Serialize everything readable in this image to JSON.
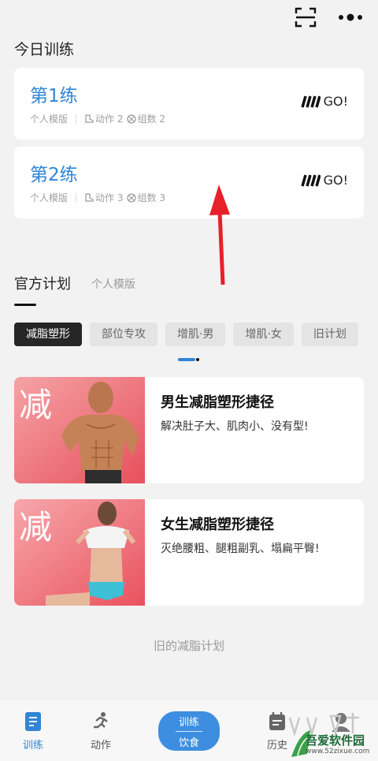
{
  "topbar": {
    "icons": [
      "scan-icon",
      "more-icon"
    ]
  },
  "today": {
    "title": "今日训练",
    "cards": [
      {
        "name": "第1练",
        "source": "个人模版",
        "action_label": "动作",
        "action_count": "2",
        "sets_label": "组数",
        "sets_count": "2",
        "go": "GO!"
      },
      {
        "name": "第2练",
        "source": "个人模版",
        "action_label": "动作",
        "action_count": "3",
        "sets_label": "组数",
        "sets_count": "3",
        "go": "GO!"
      }
    ]
  },
  "plans_tabs": {
    "official": "官方计划",
    "personal": "个人模版"
  },
  "categories": [
    "减脂塑形",
    "部位专攻",
    "增肌·男",
    "增肌·女",
    "旧计划"
  ],
  "selected_category": "减脂塑形",
  "plans": [
    {
      "thumb_text": "减",
      "title": "男生减脂塑形捷径",
      "desc": "解决肚子大、肌肉小、没有型!"
    },
    {
      "thumb_text": "减",
      "title": "女生减脂塑形捷径",
      "desc": "灭绝腰粗、腿粗副乳、塌扁平臀!"
    }
  ],
  "old_plans_link": "旧的减脂计划",
  "bottom_nav": {
    "train": "训练",
    "action": "动作",
    "center_top": "训练",
    "center_bottom": "饮食",
    "history": "历史"
  },
  "watermark": {
    "name": "吾爱软件园",
    "url": "www.52zixue.com"
  },
  "colors": {
    "accent": "#2f86d6",
    "center_button": "#3d8ee0",
    "arrow": "#e8202a",
    "thumb_bg": "#f27a85"
  }
}
